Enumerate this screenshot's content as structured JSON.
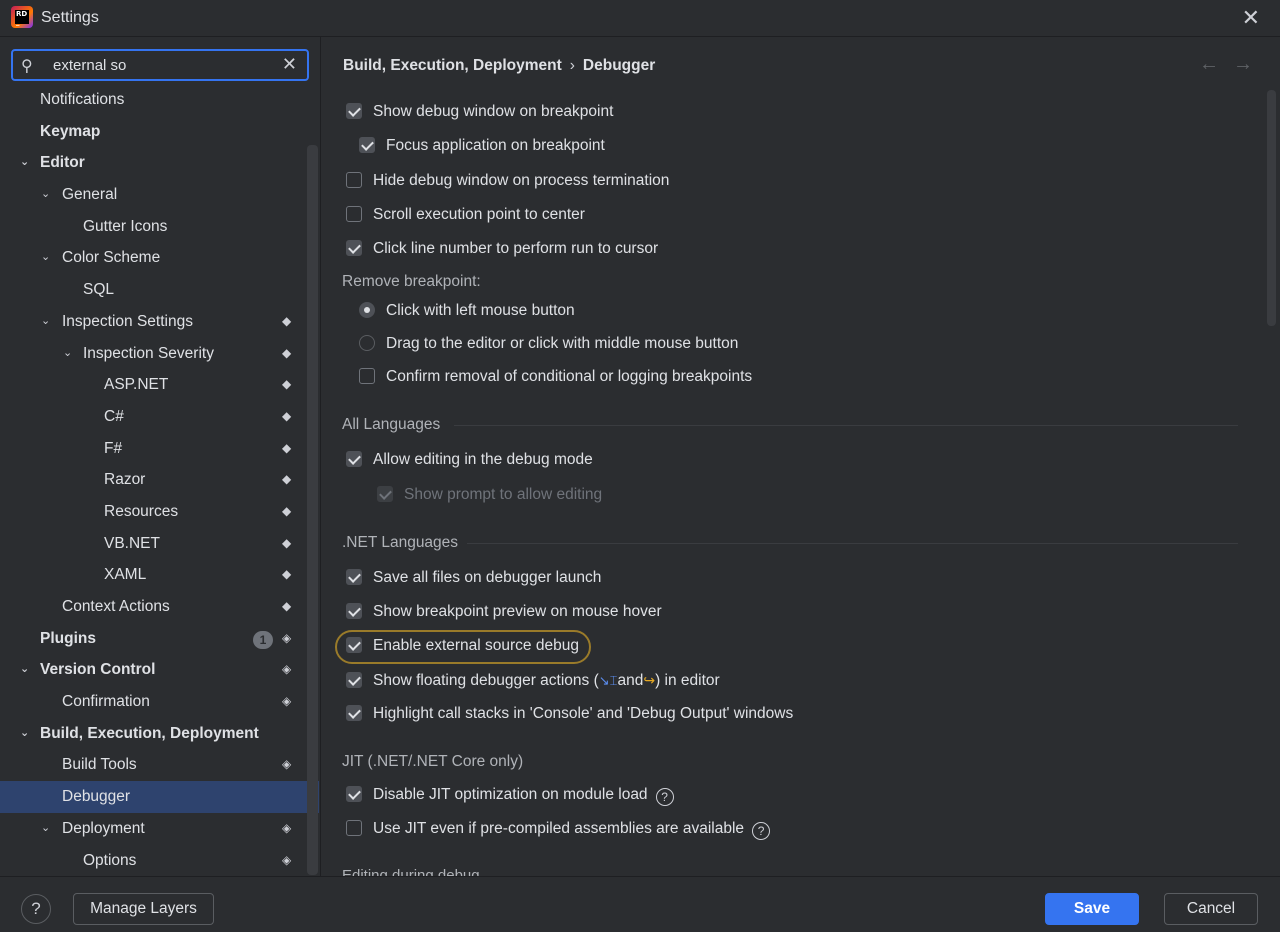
{
  "window": {
    "title": "Settings"
  },
  "search": {
    "value": "external so"
  },
  "tree": [
    {
      "label": "Notifications",
      "indent": 0,
      "bold": false,
      "chevron": "",
      "layer": ""
    },
    {
      "label": "Keymap",
      "indent": 0,
      "bold": true,
      "chevron": "",
      "layer": ""
    },
    {
      "label": "Editor",
      "indent": 0,
      "bold": true,
      "chevron": "⌄",
      "layer": ""
    },
    {
      "label": "General",
      "indent": 1,
      "bold": false,
      "chevron": "⌄",
      "layer": ""
    },
    {
      "label": "Gutter Icons",
      "indent": 2,
      "bold": false,
      "chevron": "",
      "layer": ""
    },
    {
      "label": "Color Scheme",
      "indent": 1,
      "bold": false,
      "chevron": "⌄",
      "layer": ""
    },
    {
      "label": "SQL",
      "indent": 2,
      "bold": false,
      "chevron": "",
      "layer": ""
    },
    {
      "label": "Inspection Settings",
      "indent": 1,
      "bold": false,
      "chevron": "⌄",
      "layer": "◆"
    },
    {
      "label": "Inspection Severity",
      "indent": 2,
      "bold": false,
      "chevron": "⌄",
      "layer": "◆"
    },
    {
      "label": "ASP.NET",
      "indent": 3,
      "bold": false,
      "chevron": "",
      "layer": "◆"
    },
    {
      "label": "C#",
      "indent": 3,
      "bold": false,
      "chevron": "",
      "layer": "◆"
    },
    {
      "label": "F#",
      "indent": 3,
      "bold": false,
      "chevron": "",
      "layer": "◆"
    },
    {
      "label": "Razor",
      "indent": 3,
      "bold": false,
      "chevron": "",
      "layer": "◆"
    },
    {
      "label": "Resources",
      "indent": 3,
      "bold": false,
      "chevron": "",
      "layer": "◆"
    },
    {
      "label": "VB.NET",
      "indent": 3,
      "bold": false,
      "chevron": "",
      "layer": "◆"
    },
    {
      "label": "XAML",
      "indent": 3,
      "bold": false,
      "chevron": "",
      "layer": "◆"
    },
    {
      "label": "Context Actions",
      "indent": 1,
      "bold": false,
      "chevron": "",
      "layer": "◆"
    },
    {
      "label": "Plugins",
      "indent": 0,
      "bold": true,
      "chevron": "",
      "layer": "◈",
      "badge": "1"
    },
    {
      "label": "Version Control",
      "indent": 0,
      "bold": true,
      "chevron": "⌄",
      "layer": "◈"
    },
    {
      "label": "Confirmation",
      "indent": 1,
      "bold": false,
      "chevron": "",
      "layer": "◈"
    },
    {
      "label": "Build, Execution, Deployment",
      "indent": 0,
      "bold": true,
      "chevron": "⌄",
      "layer": ""
    },
    {
      "label": "Build Tools",
      "indent": 1,
      "bold": false,
      "chevron": "",
      "layer": "◈"
    },
    {
      "label": "Debugger",
      "indent": 1,
      "bold": false,
      "chevron": "",
      "layer": "",
      "selected": true
    },
    {
      "label": "Deployment",
      "indent": 1,
      "bold": false,
      "chevron": "⌄",
      "layer": "◈"
    },
    {
      "label": "Options",
      "indent": 2,
      "bold": false,
      "chevron": "",
      "layer": "◈"
    }
  ],
  "breadcrumb": {
    "parent": "Build, Execution, Deployment",
    "separator": "›",
    "current": "Debugger"
  },
  "nav": {
    "back": "←",
    "forward": "→"
  },
  "options": {
    "show_debug_window": {
      "label": "Show debug window on breakpoint",
      "checked": true
    },
    "focus_app": {
      "label": "Focus application on breakpoint",
      "checked": true
    },
    "hide_debug_window": {
      "label": "Hide debug window on process termination",
      "checked": false
    },
    "scroll_exec_point": {
      "label": "Scroll execution point to center",
      "checked": false
    },
    "click_line_number": {
      "label": "Click line number to perform run to cursor",
      "checked": true
    },
    "remove_breakpoint_label": "Remove breakpoint:",
    "remove_left_click": {
      "label": "Click with left mouse button",
      "selected": true
    },
    "remove_drag": {
      "label": "Drag to the editor or click with middle mouse button",
      "selected": false
    },
    "confirm_removal": {
      "label": "Confirm removal of conditional or logging breakpoints",
      "checked": false
    },
    "all_languages_title": "All Languages",
    "allow_editing": {
      "label": "Allow editing in the debug mode",
      "checked": true
    },
    "show_prompt": {
      "label": "Show prompt to allow editing",
      "checked": true,
      "disabled": true
    },
    "net_languages_title": ".NET Languages",
    "save_all_files": {
      "label": "Save all files on debugger launch",
      "checked": true
    },
    "bp_preview": {
      "label": "Show breakpoint preview on mouse hover",
      "checked": true
    },
    "external_source": {
      "label": "Enable external source debug",
      "checked": true
    },
    "floating_actions": {
      "label_before": "Show floating debugger actions (",
      "label_and": "and",
      "label_after": ") in editor",
      "checked": true
    },
    "highlight_stacks": {
      "label": "Highlight call stacks in 'Console' and 'Debug Output' windows",
      "checked": true
    },
    "jit_title": "JIT (.NET/.NET Core only)",
    "disable_jit": {
      "label": "Disable JIT optimization on module load",
      "checked": true
    },
    "use_jit": {
      "label": "Use JIT even if pre-compiled assemblies are available",
      "checked": false
    },
    "cutoff_section": "Editing during debug"
  },
  "footer": {
    "help": "?",
    "manage_layers": "Manage Layers",
    "save": "Save",
    "cancel": "Cancel"
  },
  "colors": {
    "accent": "#3574f0",
    "selection": "#2e436e",
    "highlight_ring": "#9a7b2a",
    "background": "#2b2d30"
  }
}
